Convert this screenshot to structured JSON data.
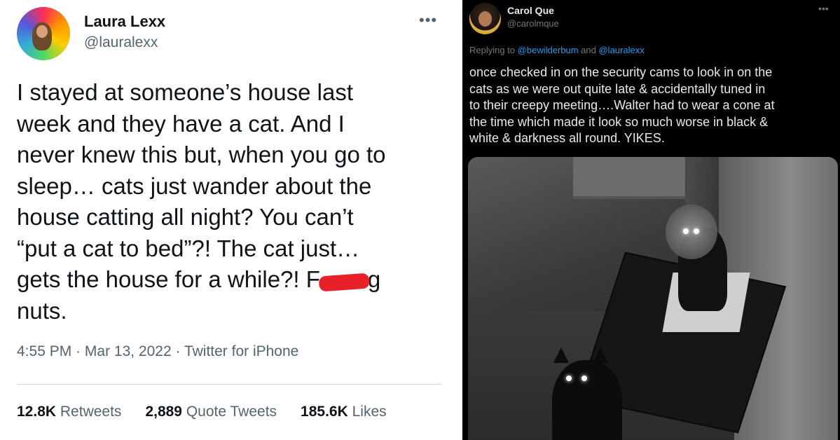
{
  "left_tweet": {
    "name": "Laura Lexx",
    "handle": "@lauralexx",
    "more": "•••",
    "body_lines": [
      "I stayed at someone’s house last",
      "week and they have a cat. And I",
      "never knew this but, when you go to",
      "sleep… cats just wander about the",
      "house catting all night? You can’t",
      "“put a cat to bed”?! The cat just…",
      "gets the house for a while?! F",
      "nuts."
    ],
    "body_censor_tail": "g",
    "time": "4:55 PM",
    "sep1": " · ",
    "date": "Mar 13, 2022",
    "sep2": " · ",
    "client": "Twitter for iPhone",
    "stats": {
      "retweets_count": "12.8K",
      "retweets_label": "Retweets",
      "quotes_count": "2,889",
      "quotes_label": "Quote Tweets",
      "likes_count": "185.6K",
      "likes_label": "Likes"
    }
  },
  "right_tweet": {
    "name": "Carol Que",
    "handle": "@carolmque",
    "more": "•••",
    "replying_prefix": "Replying to ",
    "reply_user1": "@bewilderbum",
    "reply_and": " and ",
    "reply_user2": "@lauralexx",
    "body_lines": [
      "once checked in on the security cams to look in on the",
      "cats as we were out quite late & accidentally tuned in",
      "to their creepy meeting….Walter had to wear a cone at",
      "the time which made it look so much worse in black &",
      "white & darkness all round. YIKES."
    ]
  }
}
